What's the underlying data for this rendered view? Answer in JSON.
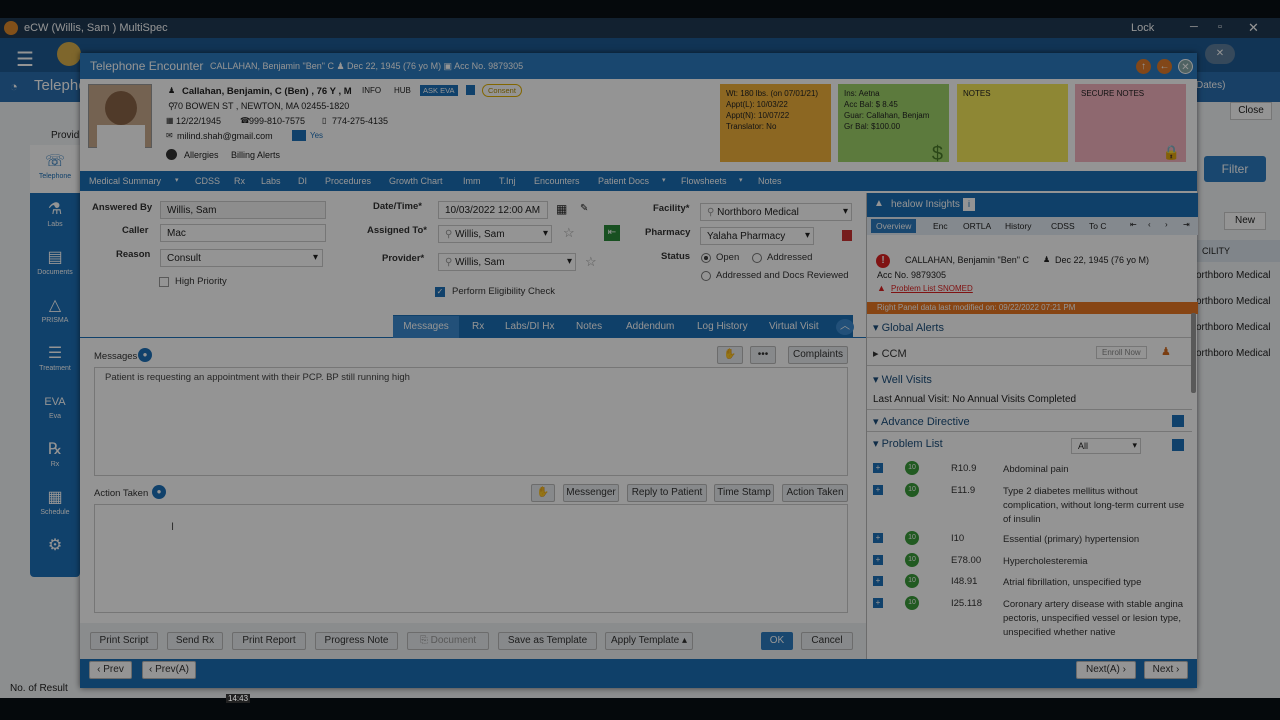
{
  "window": {
    "title": "eCW (Willis, Sam ) MultiSpec",
    "lock": "Lock"
  },
  "background": {
    "module": "Telephone",
    "filter": "Filter",
    "new": "New",
    "close": "Close",
    "dates": "Dates)",
    "provider": "Provid",
    "facility_col": "CILITY",
    "rows": [
      "orthboro Medical",
      "orthboro Medical",
      "orthboro Medical",
      "orthboro Medical"
    ],
    "no_of_result": "No. of Result",
    "time": "14:43"
  },
  "left_nav": [
    {
      "label": "Telephone",
      "icon": "☏"
    },
    {
      "label": "Labs",
      "icon": "⚗"
    },
    {
      "label": "Documents",
      "icon": "▤"
    },
    {
      "label": "PRISMA",
      "icon": "△"
    },
    {
      "label": "Treatment",
      "icon": "☰"
    },
    {
      "label": "Eva",
      "icon": "EVA"
    },
    {
      "label": "Rx",
      "icon": "℞"
    },
    {
      "label": "Schedule",
      "icon": "▦"
    },
    {
      "label": "",
      "icon": "⚙"
    }
  ],
  "dialog": {
    "title": "Telephone Encounter",
    "subtitle": "CALLAHAN, Benjamin \"Ben\" C   ♟ Dec 22, 1945 (76 yo M)   ▣ Acc No. 9879305",
    "patient": {
      "name": "Callahan, Benjamin, C (Ben) , 76 Y , M",
      "info": "INFO",
      "hub": "HUB",
      "ask_eva": "ASK EVA",
      "consent": "Consent",
      "address": "70 BOWEN ST , NEWTON, MA 02455-1820",
      "dob": "12/22/1945",
      "phone1": "999-810-7575",
      "phone2": "774-275-4135",
      "email": "milind.shah@gmail.com",
      "yes": "Yes",
      "allergies": "Allergies",
      "billing": "Billing Alerts"
    },
    "cards": [
      {
        "lines": [
          "Wt: 180 lbs. (on 07/01/21)",
          "Appt(L): 10/03/22",
          "Appt(N): 10/07/22",
          "Translator: No"
        ],
        "color": "#f1b23c"
      },
      {
        "lines": [
          "Ins: Aetna",
          "Acc Bal: $ 8.45",
          "Guar: Callahan, Benjam",
          "Gr Bal: $100.00"
        ],
        "color": "#9fd36a"
      },
      {
        "lines": [
          "NOTES"
        ],
        "color": "#f5e85a"
      },
      {
        "lines": [
          "SECURE NOTES"
        ],
        "color": "#f4b3bf"
      }
    ],
    "tabs": [
      "Medical Summary",
      "CDSS",
      "Rx",
      "Labs",
      "DI",
      "Procedures",
      "Growth Chart",
      "Imm",
      "T.Inj",
      "Encounters",
      "Patient Docs",
      "Flowsheets",
      "Notes"
    ],
    "form": {
      "answered_by_label": "Answered By",
      "answered_by": "Willis, Sam",
      "caller_label": "Caller",
      "caller": "Mac",
      "reason_label": "Reason",
      "reason": "Consult",
      "high_priority": "High Priority",
      "datetime_label": "Date/Time*",
      "datetime": "10/03/2022 12:00 AM",
      "assigned_label": "Assigned To*",
      "assigned": "Willis, Sam",
      "provider_label": "Provider*",
      "provider": "Willis, Sam",
      "eligibility": "Perform Eligibility Check",
      "facility_label": "Facility*",
      "facility": "Northboro Medical",
      "pharmacy_label": "Pharmacy",
      "pharmacy": "Yalaha Pharmacy",
      "status_label": "Status",
      "status_open": "Open",
      "status_addressed": "Addressed",
      "status_docs": "Addressed and Docs Reviewed"
    },
    "subtabs": [
      "Messages",
      "Rx",
      "Labs/DI Hx",
      "Notes",
      "Addendum",
      "Log History",
      "Virtual Visit"
    ],
    "messages_label": "Messages",
    "complaints": "Complaints",
    "message_text": "Patient is requesting an appointment with their PCP. BP still running high",
    "action_label": "Action Taken",
    "action_buttons": [
      "Messenger",
      "Reply to Patient",
      "Time Stamp",
      "Action Taken"
    ],
    "bottom_buttons": [
      "Print Script",
      "Send Rx",
      "Print Report",
      "Progress Note",
      "Document",
      "Save as Template",
      "Apply Template"
    ],
    "ok": "OK",
    "cancel": "Cancel",
    "prev": "Prev",
    "prevA": "Prev(A)",
    "nextA": "Next(A)",
    "next": "Next"
  },
  "insights": {
    "title": "healow Insights",
    "tabs": [
      "Overview",
      "Enc",
      "ORTLA",
      "History",
      "CDSS",
      "To C"
    ],
    "patient": "CALLAHAN, Benjamin \"Ben\" C",
    "dob": "Dec 22, 1945 (76 yo M)",
    "acc": "Acc No. 9879305",
    "snomed": "Problem List SNOMED",
    "modified": "Right Panel data last modified on: 09/22/2022 07:21 PM",
    "global_alerts": "Global Alerts",
    "ccm": "CCM",
    "enroll": "Enroll Now",
    "well_visits": "Well Visits",
    "annual": "Last Annual Visit: No Annual Visits Completed",
    "advance": "Advance Directive",
    "problem_list": "Problem List",
    "all": "All",
    "problems": [
      {
        "code": "R10.9",
        "desc": "Abdominal pain"
      },
      {
        "code": "E11.9",
        "desc": "Type 2 diabetes mellitus without complication, without long-term current use of insulin"
      },
      {
        "code": "I10",
        "desc": "Essential (primary) hypertension"
      },
      {
        "code": "E78.00",
        "desc": "Hypercholesteremia"
      },
      {
        "code": "I48.91",
        "desc": "Atrial fibrillation, unspecified type"
      },
      {
        "code": "I25.118",
        "desc": "Coronary artery disease with stable angina pectoris, unspecified vessel or lesion type, unspecified whether native"
      }
    ]
  }
}
